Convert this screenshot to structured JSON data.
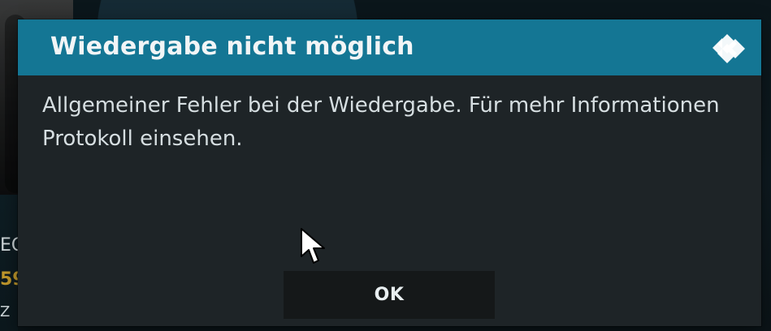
{
  "background": {
    "left_partial_texts": [
      "EC",
      "59",
      "Z"
    ],
    "accent_color": "#c39a2c"
  },
  "dialog": {
    "title": "Wiedergabe nicht möglich",
    "message": "Allgemeiner Fehler bei der Wiedergabe. Für mehr Informationen Protokoll einsehen.",
    "ok_label": "OK",
    "header_color": "#147694",
    "icon": "kodi-logo-icon"
  },
  "cursor": {
    "icon": "mouse-pointer-icon"
  }
}
